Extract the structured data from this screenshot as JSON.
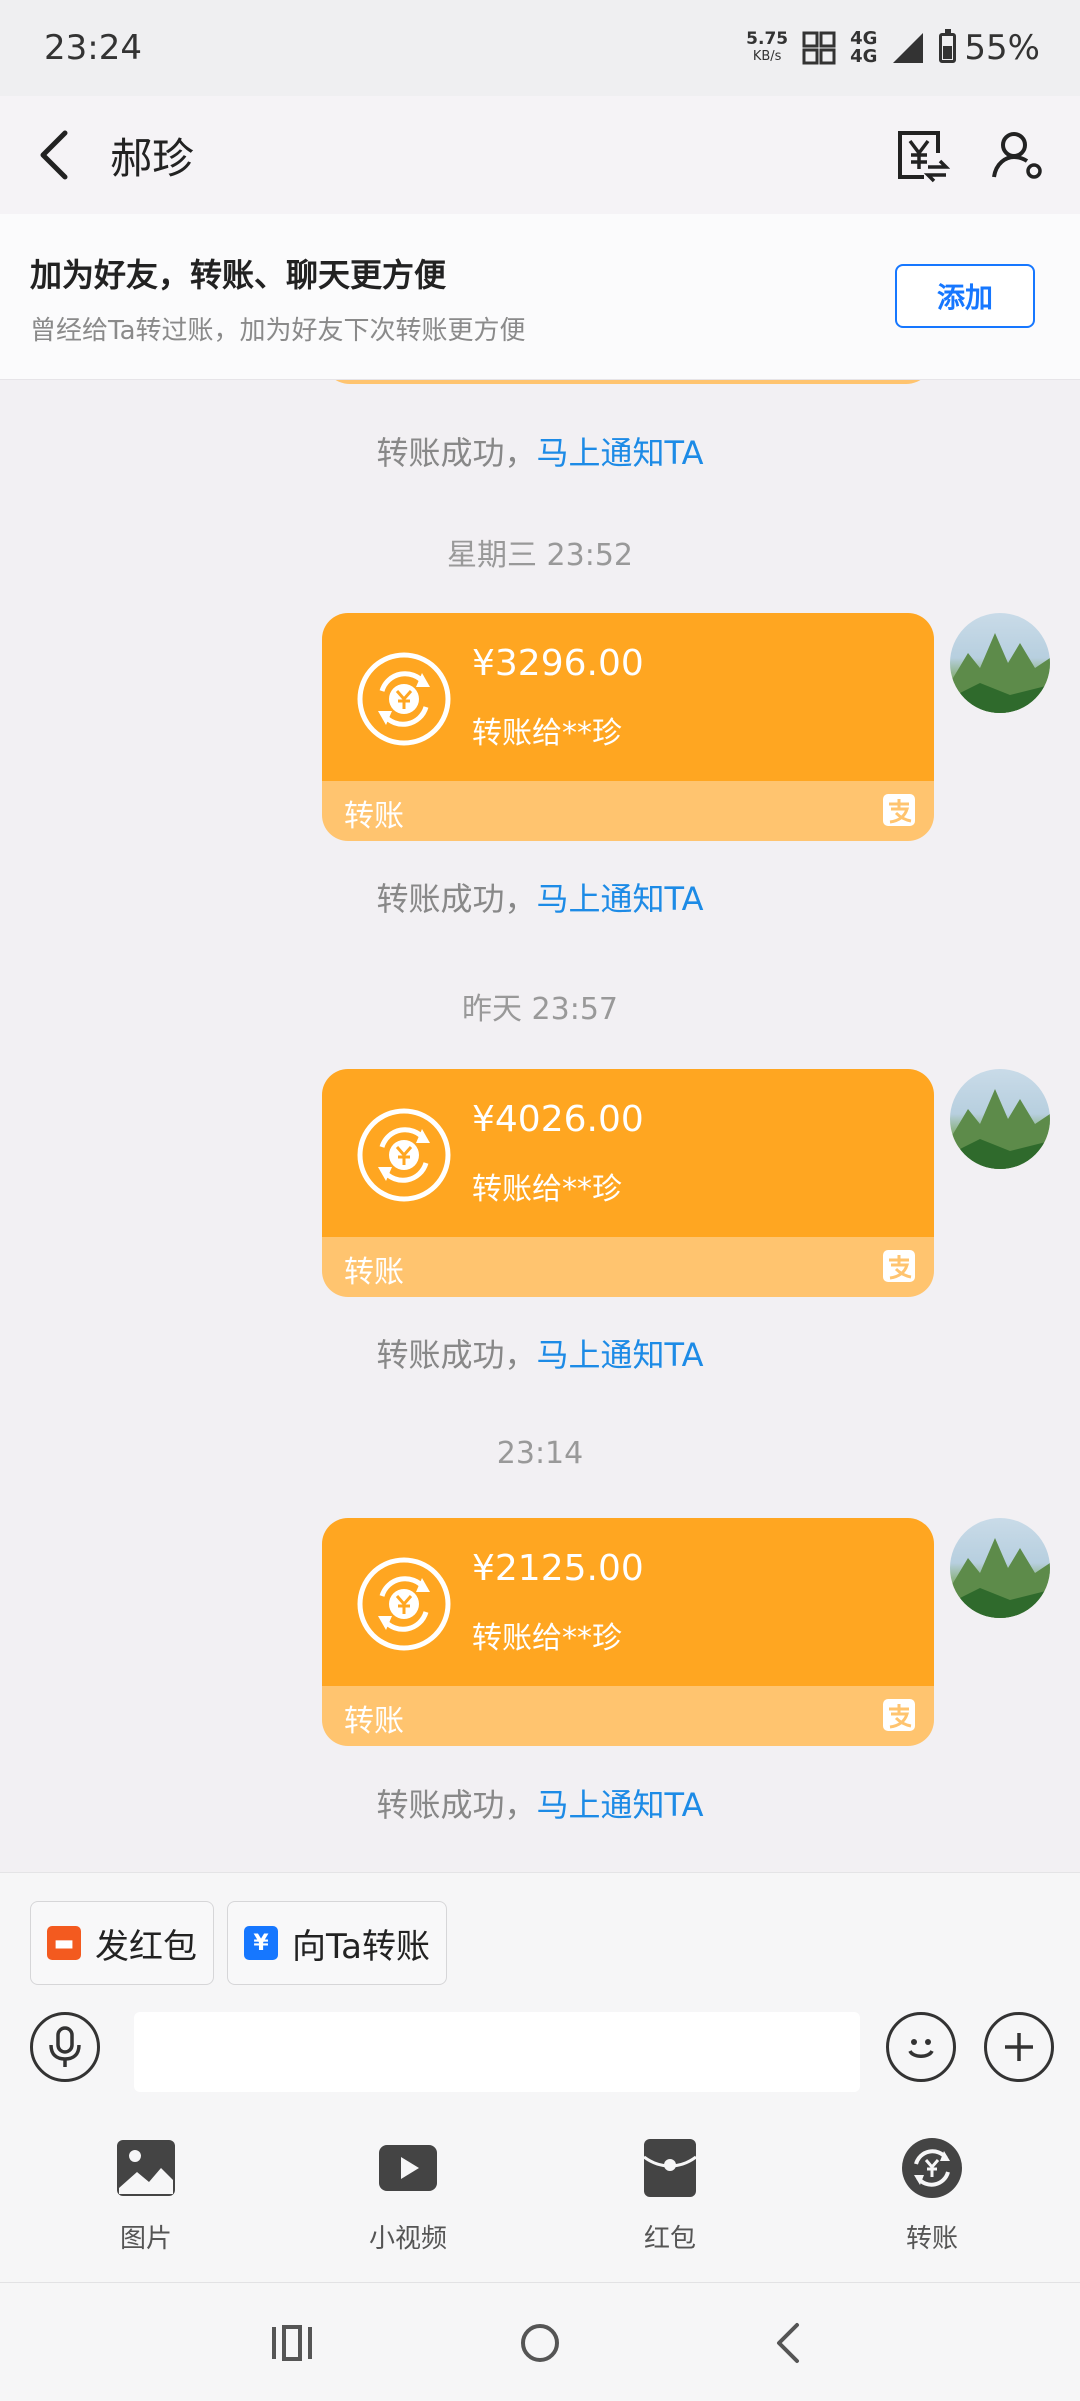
{
  "status_bar": {
    "time": "23:24",
    "net_speed": "5.75",
    "net_unit": "KB/s",
    "signal_top": "4G",
    "signal_bottom": "4G",
    "battery": "55%"
  },
  "header": {
    "title": "郝珍"
  },
  "banner": {
    "title": "加为好友，转账、聊天更方便",
    "subtitle": "曾经给Ta转过账，加为好友下次转账更方便",
    "add_label": "添加"
  },
  "chat": {
    "notice_prefix": "转账成功，",
    "notice_link": "马上通知TA",
    "messages": [
      {
        "timestamp": "星期三 23:52",
        "amount": "¥3296.00",
        "to": "转账给**珍",
        "type": "转账"
      },
      {
        "timestamp": "昨天 23:57",
        "amount": "¥4026.00",
        "to": "转账给**珍",
        "type": "转账"
      },
      {
        "timestamp": "23:14",
        "amount": "¥2125.00",
        "to": "转账给**珍",
        "type": "转账"
      }
    ]
  },
  "chips": {
    "red_packet": "发红包",
    "transfer": "向Ta转账"
  },
  "input": {
    "placeholder": ""
  },
  "tools": [
    {
      "label": "图片",
      "icon": "image-icon"
    },
    {
      "label": "小视频",
      "icon": "video-icon"
    },
    {
      "label": "红包",
      "icon": "red-packet-icon"
    },
    {
      "label": "转账",
      "icon": "transfer-icon"
    }
  ],
  "colors": {
    "accent_blue": "#1677ff",
    "link_blue": "#1d8be6",
    "transfer_orange": "#ffa621",
    "transfer_light": "#ffc46f"
  }
}
